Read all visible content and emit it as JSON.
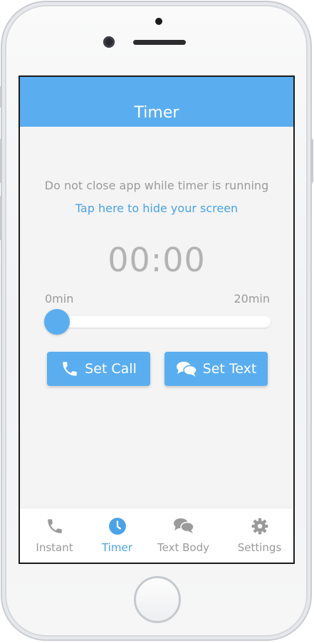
{
  "navbar": {
    "title": "Timer"
  },
  "main": {
    "warning_text": "Do not close app while timer is running",
    "hide_link": "Tap here to hide your screen",
    "timer_value": "00:00",
    "slider": {
      "min_label": "0min",
      "max_label": "20min",
      "value_min": 0,
      "range_min": [
        0,
        20
      ]
    },
    "buttons": {
      "call_label": "Set Call",
      "text_label": "Set Text"
    }
  },
  "tabbar": {
    "active": "timer",
    "tabs": [
      {
        "label": "Instant",
        "icon": "phone-icon"
      },
      {
        "label": "Timer",
        "icon": "clock-icon"
      },
      {
        "label": "Text Body",
        "icon": "chat-bubbles-icon"
      },
      {
        "label": "Settings",
        "icon": "gear-icon"
      }
    ]
  },
  "colors": {
    "accent": "#5aaef0",
    "link": "#4aa3e8",
    "muted_text": "#9a9a9a",
    "background": "#f4f4f4"
  }
}
